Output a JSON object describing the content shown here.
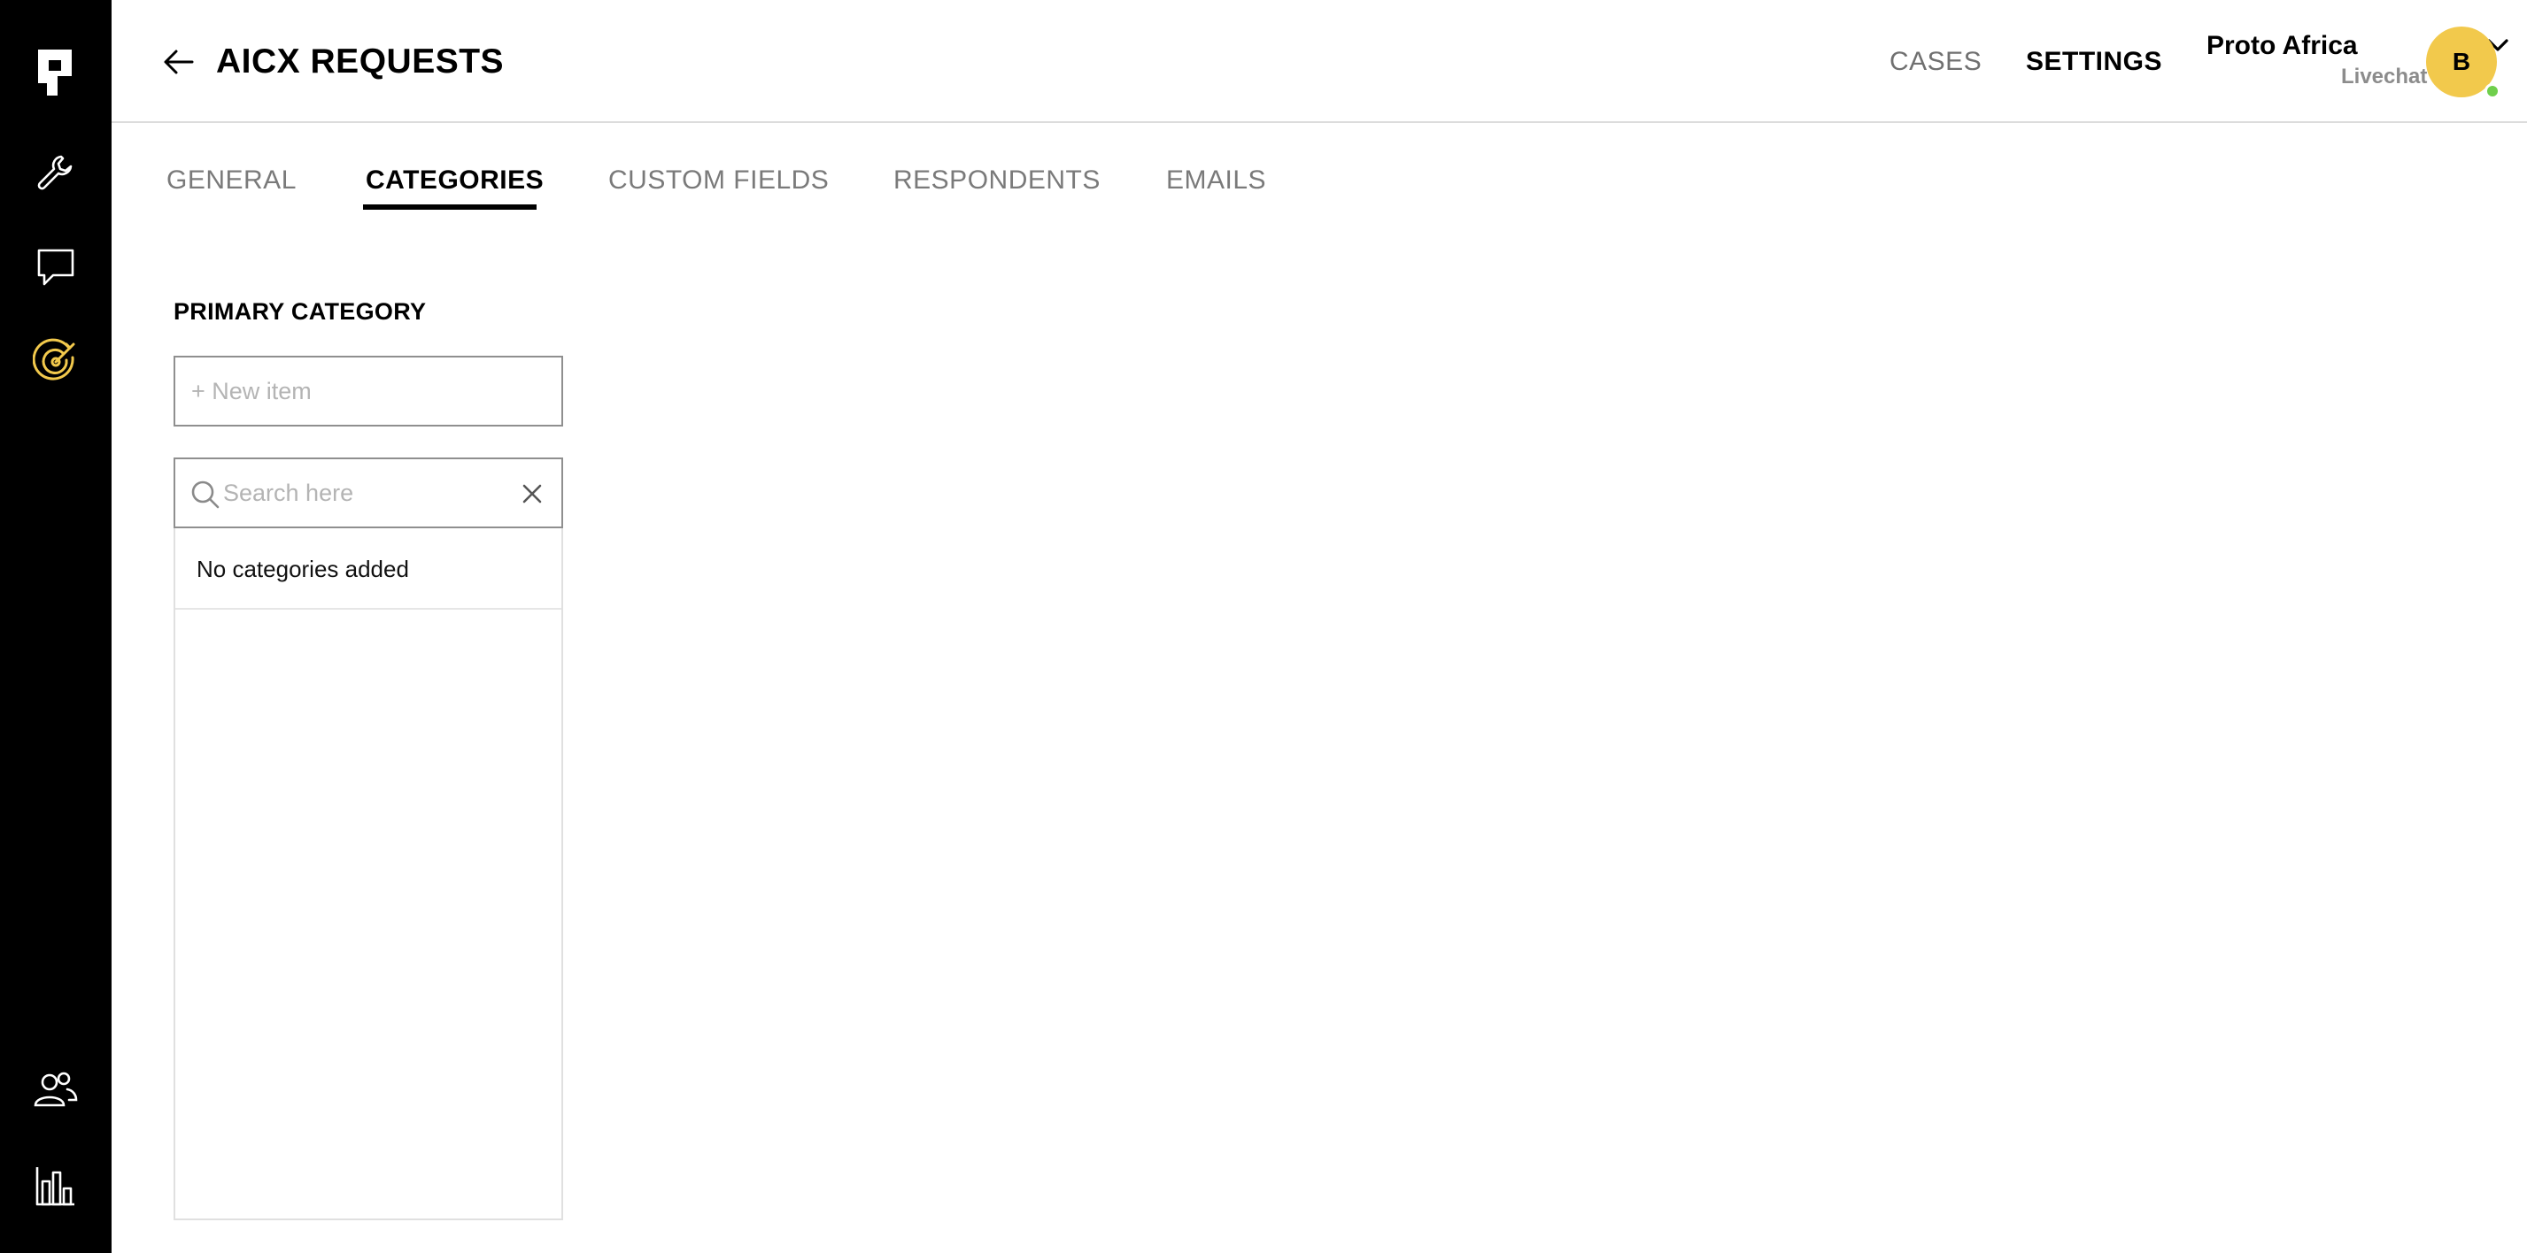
{
  "app": {
    "brand_color": "#000000",
    "accent_color": "#F2C94C",
    "status_color": "#6FCF4C"
  },
  "sidebar": {
    "items": [
      {
        "name": "logo",
        "icon": "logo-icon"
      },
      {
        "name": "tools",
        "icon": "wrench-icon"
      },
      {
        "name": "chat",
        "icon": "chat-bubble-icon"
      },
      {
        "name": "target",
        "icon": "target-icon",
        "active": true
      },
      {
        "name": "users",
        "icon": "users-icon"
      },
      {
        "name": "reports",
        "icon": "bar-chart-icon"
      }
    ]
  },
  "header": {
    "title": "AICX REQUESTS",
    "back_icon": "arrow-left-icon",
    "nav": {
      "cases": "CASES",
      "settings": "SETTINGS"
    },
    "org": {
      "name": "Proto Africa",
      "sub": "Livechat"
    },
    "avatar": {
      "initial": "B",
      "status": "online"
    }
  },
  "tabs": [
    {
      "label": "GENERAL"
    },
    {
      "label": "CATEGORIES",
      "active": true
    },
    {
      "label": "CUSTOM FIELDS"
    },
    {
      "label": "RESPONDENTS"
    },
    {
      "label": "EMAILS"
    }
  ],
  "main": {
    "section_title": "PRIMARY CATEGORY",
    "new_item": {
      "placeholder": "+ New item",
      "value": ""
    },
    "search": {
      "placeholder": "Search here",
      "value": ""
    },
    "empty_message": "No categories added"
  }
}
